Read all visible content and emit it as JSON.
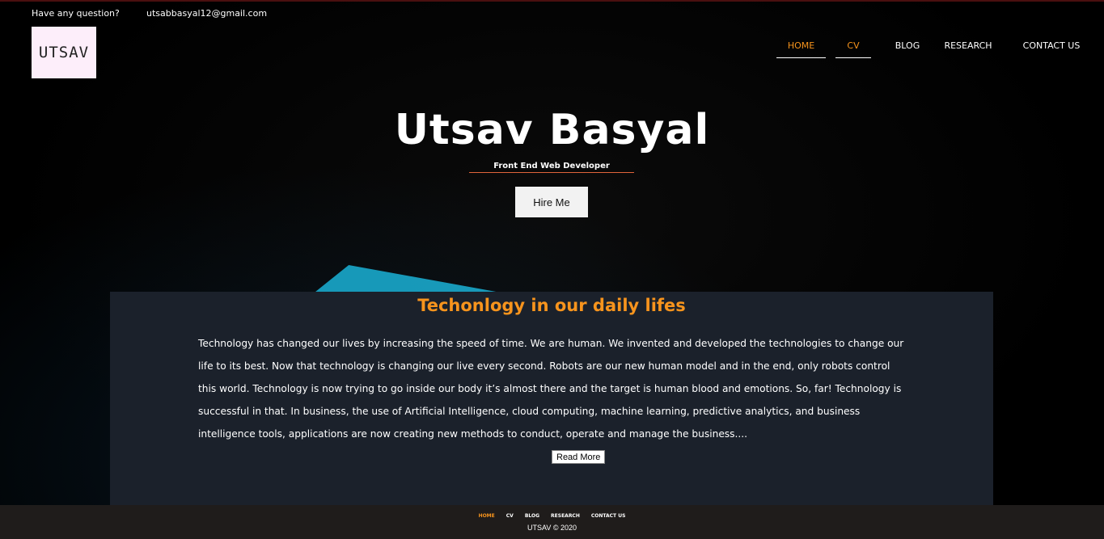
{
  "topbar": {
    "question": "Have any question?",
    "email": "utsabbasyal12@gmail.com"
  },
  "logo": {
    "text": "UTSAV"
  },
  "nav": {
    "items": [
      "HOME",
      "CV",
      "BLOG",
      "RESEARCH",
      "CONTACT US"
    ]
  },
  "hero": {
    "name": "Utsav Basyal",
    "subtitle": "Front End Web Developer",
    "cta": "Hire Me"
  },
  "article": {
    "title": "Techonlogy in our daily lifes",
    "body": "Technology has changed our lives by increasing the speed of time. We are human. We invented and developed the technologies to change our life to its best. Now that technology is changing our live every second. Robots are our new human model and in the end, only robots control this world. Technology is now trying to go inside our body it’s almost there and the target is human blood and emotions. So, far! Technology is successful in that. In business, the use of Artificial Intelligence, cloud computing, machine learning, predictive analytics, and business intelligence tools, applications are now creating new methods to conduct, operate and manage the business....",
    "read_more": "Read More"
  },
  "footer": {
    "nav": [
      "HOME",
      "CV",
      "BLOG",
      "RESEARCH",
      "CONTACT US"
    ],
    "copyright": "UTSAV © 2020"
  },
  "colors": {
    "accent": "#f7941d",
    "card_bg": "#1b212b",
    "footer_bg": "#1f1c1b"
  }
}
